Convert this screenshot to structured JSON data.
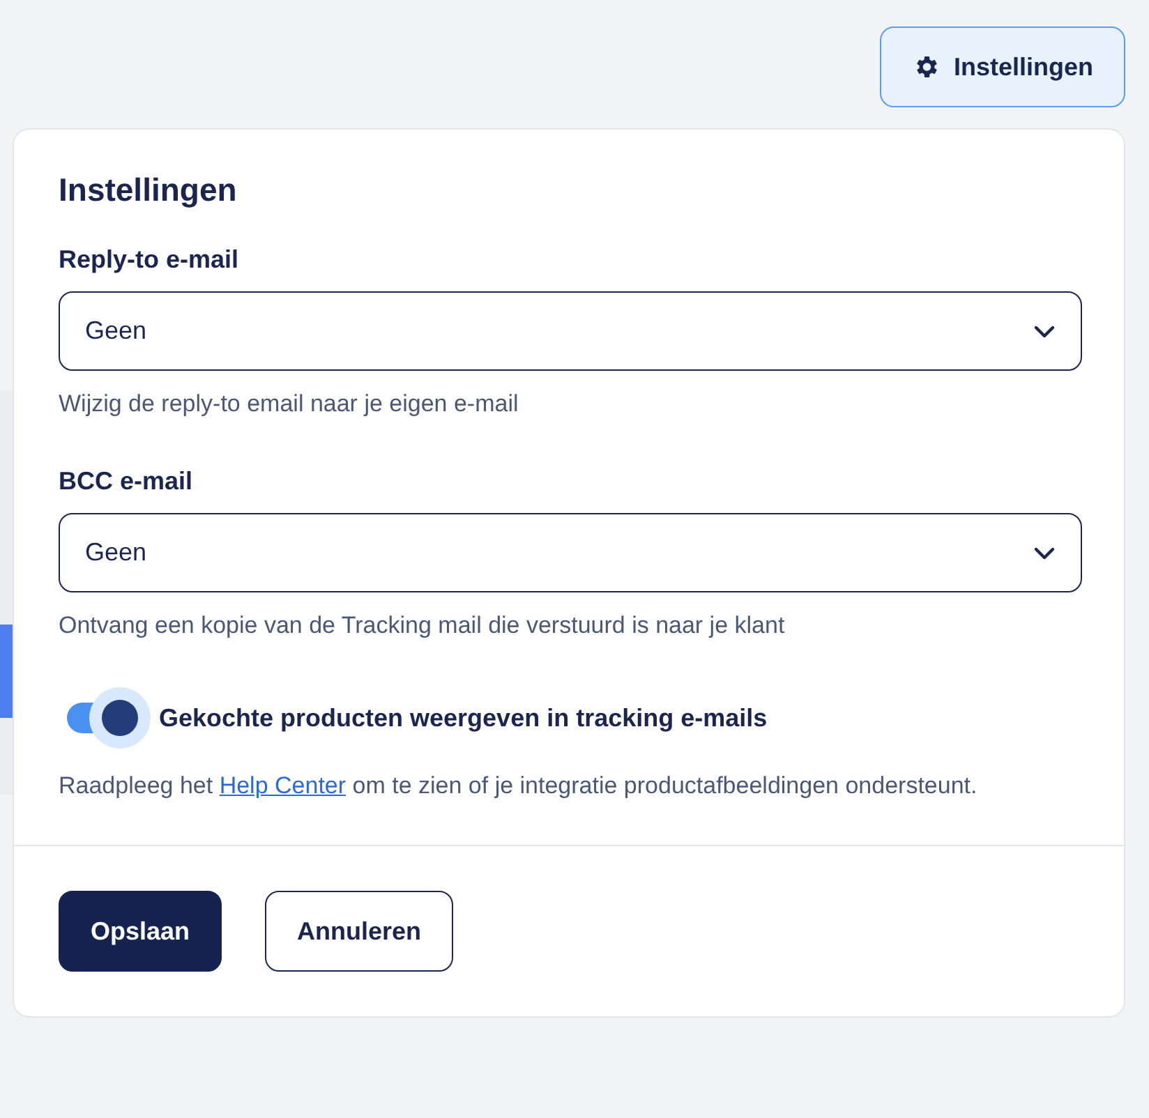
{
  "header_button": {
    "label": "Instellingen"
  },
  "panel": {
    "title": "Instellingen",
    "fields": [
      {
        "label": "Reply-to e-mail",
        "value": "Geen",
        "hint": "Wijzig de reply-to email naar je eigen e-mail"
      },
      {
        "label": "BCC e-mail",
        "value": "Geen",
        "hint": "Ontvang een kopie van de Tracking mail die verstuurd is naar je klant"
      }
    ],
    "toggle": {
      "on": true,
      "label": "Gekochte producten weergeven in tracking e-mails"
    },
    "note": {
      "before": "Raadpleeg het",
      "link": "Help Center",
      "after": "om te zien of je integratie productafbeeldingen ondersteunt."
    },
    "buttons": [
      {
        "label": "Opslaan",
        "kind": "primary"
      },
      {
        "label": "Annuleren",
        "kind": "secondary"
      }
    ]
  }
}
